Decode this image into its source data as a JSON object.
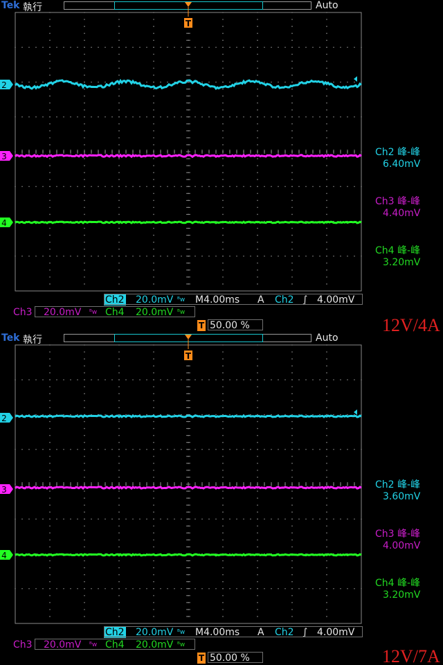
{
  "colors": {
    "ch2": "#22d2e6",
    "ch3": "#ff22ff",
    "ch4": "#22ff22",
    "trigger": "#ff8c1a",
    "grid": "#8a8a8a",
    "text": "#e8e8e8",
    "brand": "#2f6fd8",
    "annotation": "#e02020"
  },
  "icons": {
    "trigger_marker": "T",
    "rising_edge": "∫",
    "bandwidth": "ᴮw"
  },
  "screens": [
    {
      "brand": "Tek",
      "run_state": "執行",
      "trigger_mode": "Auto",
      "channel_markers": [
        "2",
        "3",
        "4"
      ],
      "measurements": [
        {
          "name": "Ch2 峰-峰",
          "value": "6.40mV"
        },
        {
          "name": "Ch3 峰-峰",
          "value": "4.40mV"
        },
        {
          "name": "Ch4 峰-峰",
          "value": "3.20mV"
        }
      ],
      "status": {
        "ch2_label": "Ch2",
        "ch2_scale": "20.0mV",
        "timebase": "M4.00ms",
        "trigger_src_prefix": "A",
        "trigger_src": "Ch2",
        "trigger_level": "4.00mV",
        "ch3_label": "Ch3",
        "ch3_scale": "20.0mV",
        "ch4_label": "Ch4",
        "ch4_scale": "20.0mV",
        "trigger_pos_icon": "T",
        "trigger_pos": "50.00 %"
      },
      "annotation": "12V/4A",
      "traces": {
        "ch2_ripple": 6.4,
        "ch3_ripple": 4.4,
        "ch4_ripple": 3.2
      }
    },
    {
      "brand": "Tek",
      "run_state": "執行",
      "trigger_mode": "Auto",
      "channel_markers": [
        "2",
        "3",
        "4"
      ],
      "measurements": [
        {
          "name": "Ch2 峰-峰",
          "value": "3.60mV"
        },
        {
          "name": "Ch3 峰-峰",
          "value": "4.00mV"
        },
        {
          "name": "Ch4 峰-峰",
          "value": "3.20mV"
        }
      ],
      "status": {
        "ch2_label": "Ch2",
        "ch2_scale": "20.0mV",
        "timebase": "M4.00ms",
        "trigger_src_prefix": "A",
        "trigger_src": "Ch2",
        "trigger_level": "4.00mV",
        "ch3_label": "Ch3",
        "ch3_scale": "20.0mV",
        "ch4_label": "Ch4",
        "ch4_scale": "20.0mV",
        "trigger_pos_icon": "T",
        "trigger_pos": "50.00 %"
      },
      "annotation": "12V/7A",
      "traces": {
        "ch2_ripple": 3.6,
        "ch3_ripple": 4.0,
        "ch4_ripple": 3.2
      }
    }
  ]
}
